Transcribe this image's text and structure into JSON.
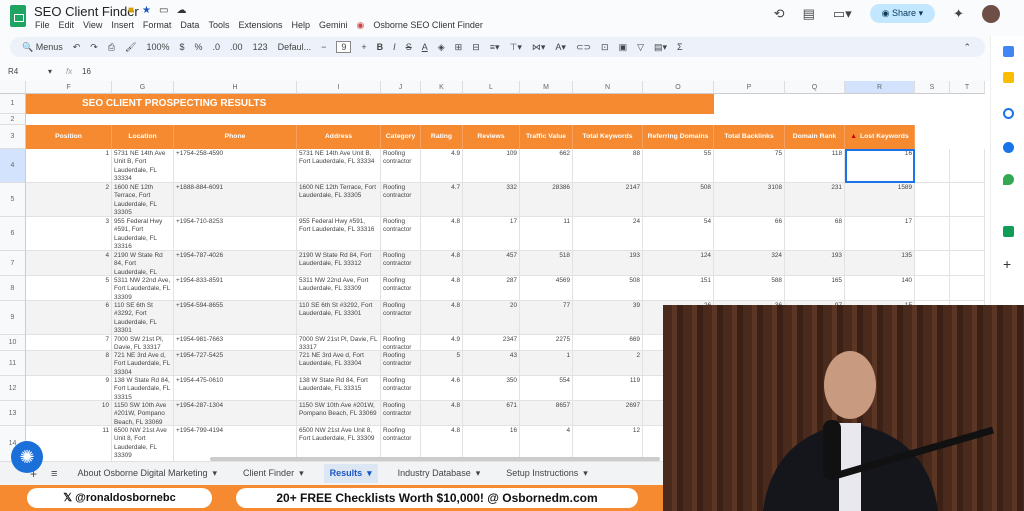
{
  "app": {
    "title": "SEO Client Finder",
    "menu": [
      "File",
      "Edit",
      "View",
      "Insert",
      "Format",
      "Data",
      "Tools",
      "Extensions",
      "Help",
      "Gemini",
      "Osborne SEO Client Finder"
    ],
    "share": "Share"
  },
  "toolbar": {
    "menus": "Menus",
    "zoom": "100%",
    "currency": "$",
    "percent": "%",
    "dec_less": ".0",
    "dec_more": ".00",
    "format123": "123",
    "font": "Defaul...",
    "font_size": "9",
    "bold": "B",
    "italic": "I",
    "strike": "S",
    "text_color": "A",
    "sum": "Σ"
  },
  "formula": {
    "cell_ref": "R4",
    "fx": "fx",
    "value": "16"
  },
  "columns": [
    "F",
    "G",
    "H",
    "I",
    "J",
    "K",
    "L",
    "M",
    "N",
    "O",
    "P",
    "Q",
    "R",
    "S",
    "T"
  ],
  "row_numbers": [
    "1",
    "2",
    "3",
    "4",
    "5",
    "6",
    "7",
    "8",
    "9",
    "10",
    "11",
    "12",
    "13",
    "14"
  ],
  "banner": "SEO CLIENT PROSPECTING RESULTS",
  "headers": [
    "Position",
    "Location",
    "Phone",
    "Address",
    "Category",
    "Rating",
    "Reviews",
    "Traffic Value",
    "Total Keywords",
    "Referring Domains",
    "Total Backlinks",
    "Domain Rank",
    "Lost Keywords"
  ],
  "rows": [
    [
      "1",
      "5731 NE 14th Ave Unit B, Fort Lauderdale, FL 33334",
      "+1754-258-4590",
      "5731 NE 14th Ave Unit B, Fort Lauderdale, FL 33334",
      "Roofing contractor",
      "4.9",
      "109",
      "662",
      "88",
      "55",
      "75",
      "118",
      "16"
    ],
    [
      "2",
      "1600 NE 12th Terrace, Fort Lauderdale, FL 33305",
      "+1888-884-6091",
      "1600 NE 12th Terrace, Fort Lauderdale, FL 33305",
      "Roofing contractor",
      "4.7",
      "332",
      "28386",
      "2147",
      "508",
      "3108",
      "231",
      "1589"
    ],
    [
      "3",
      "955 Federal Hwy #591, Fort Lauderdale, FL 33316",
      "+1954-710-8253",
      "955 Federal Hwy #591, Fort Lauderdale, FL 33316",
      "Roofing contractor",
      "4.8",
      "17",
      "11",
      "24",
      "54",
      "66",
      "68",
      "17"
    ],
    [
      "4",
      "2190 W State Rd 84, Fort Lauderdale, FL 33312",
      "+1954-787-4026",
      "2190 W State Rd 84, Fort Lauderdale, FL 33312",
      "Roofing contractor",
      "4.8",
      "457",
      "518",
      "193",
      "124",
      "324",
      "193",
      "135"
    ],
    [
      "5",
      "5311 NW 22nd Ave, Fort Lauderdale, FL 33309",
      "+1954-833-8591",
      "5311 NW 22nd Ave, Fort Lauderdale, FL 33309",
      "Roofing contractor",
      "4.8",
      "287",
      "4569",
      "508",
      "151",
      "588",
      "165",
      "140"
    ],
    [
      "6",
      "110 SE 6th St #3292, Fort Lauderdale, FL 33301",
      "+1954-594-8655",
      "110 SE 6th St #3292, Fort Lauderdale, FL 33301",
      "Roofing contractor",
      "4.8",
      "20",
      "77",
      "39",
      "26",
      "36",
      "97",
      "15"
    ],
    [
      "7",
      "7000 SW 21st Pl, Davie, FL 33317",
      "+1954-981-7663",
      "7000 SW 21st Pl, Davie, FL 33317",
      "Roofing contractor",
      "4.9",
      "2347",
      "2275",
      "669",
      "",
      "",
      "",
      ""
    ],
    [
      "8",
      "721 NE 3rd Ave d, Fort Lauderdale, FL 33304",
      "+1954-727-5425",
      "721 NE 3rd Ave d, Fort Lauderdale, FL 33304",
      "Roofing contractor",
      "5",
      "43",
      "1",
      "2",
      "",
      "",
      "",
      ""
    ],
    [
      "9",
      "138 W State Rd 84, Fort Lauderdale, FL 33315",
      "+1954-475-0610",
      "138 W State Rd 84, Fort Lauderdale, FL 33315",
      "Roofing contractor",
      "4.6",
      "350",
      "554",
      "119",
      "",
      "",
      "",
      ""
    ],
    [
      "10",
      "1150 SW 10th Ave #201W, Pompano Beach, FL 33069",
      "+1954-287-1304",
      "1150 SW 10th Ave #201W, Pompano Beach, FL 33069",
      "Roofing contractor",
      "4.8",
      "671",
      "8657",
      "2697",
      "",
      "",
      "",
      ""
    ],
    [
      "11",
      "6500 NW 21st Ave Unit 8, Fort Lauderdale, FL 33309",
      "+1954-799-4194",
      "6500 NW 21st Ave Unit 8, Fort Lauderdale, FL 33309",
      "Roofing contractor",
      "4.8",
      "16",
      "4",
      "12",
      "",
      "",
      "",
      ""
    ]
  ],
  "tabs": [
    "About Osborne Digital Marketing",
    "Client Finder",
    "Results",
    "Industry Database",
    "Setup Instructions"
  ],
  "active_tab": "Results",
  "promo": {
    "handle": "𝕏 @ronaldosbornebc",
    "offer": "20+ FREE Checklists Worth $10,000! @ Osbornedm.com"
  },
  "colors": {
    "accent": "#f58a30",
    "sheets_green": "#1fa463",
    "share_bg": "#c2e7ff"
  }
}
